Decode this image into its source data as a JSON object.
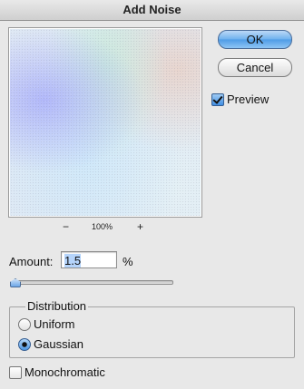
{
  "dialog": {
    "title": "Add Noise"
  },
  "preview": {
    "zoom_out": "−",
    "zoom_level": "100%",
    "zoom_in": "+"
  },
  "buttons": {
    "ok": "OK",
    "cancel": "Cancel"
  },
  "preview_toggle": {
    "label": "Preview",
    "checked": true
  },
  "amount": {
    "label": "Amount:",
    "value": "1.5",
    "unit": "%",
    "slider_fraction": 0.0
  },
  "distribution": {
    "title": "Distribution",
    "options": [
      "Uniform",
      "Gaussian"
    ],
    "selected": "Gaussian"
  },
  "monochromatic": {
    "label": "Monochromatic",
    "checked": false
  },
  "colors": {
    "ok_button": "#6eb1ee",
    "window_bg": "#e8e8e8"
  }
}
